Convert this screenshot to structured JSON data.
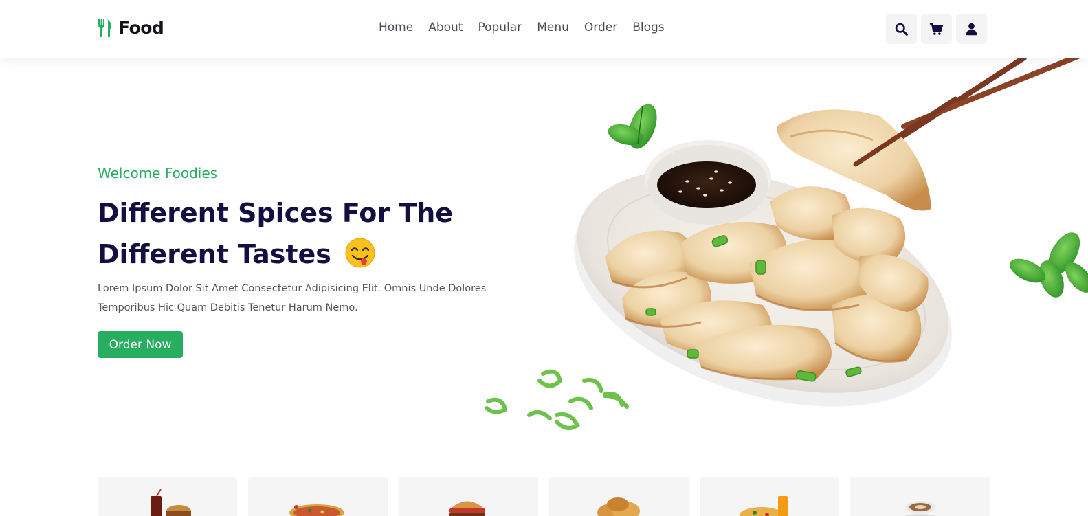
{
  "brand": {
    "name": "Food"
  },
  "nav": {
    "items": [
      "Home",
      "About",
      "Popular",
      "Menu",
      "Order",
      "Blogs"
    ]
  },
  "header_icons": [
    "search-icon",
    "cart-icon",
    "user-icon"
  ],
  "hero": {
    "welcome": "Welcome Foodies",
    "title_line1": "Different Spices For The",
    "title_line2": "Different Tastes",
    "description": "Lorem Ipsum Dolor Sit Amet Consectetur Adipisicing Elit. Omnis Unde Dolores Temporibus Hic Quam Debitis Tenetur Harum Nemo.",
    "button": "Order Now"
  },
  "categories": [
    "drink-burger",
    "pizza",
    "burger",
    "fried-chicken",
    "rice-juice",
    "coffee"
  ],
  "colors": {
    "accent": "#27ae60",
    "heading": "#130f40",
    "icon": "#130f40",
    "card_bg": "#f5f5f5"
  }
}
